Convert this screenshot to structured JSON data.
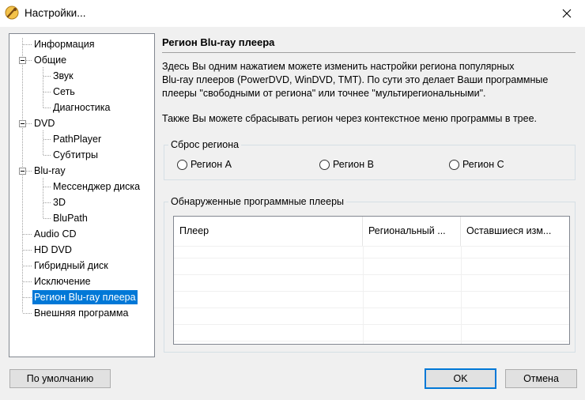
{
  "window": {
    "title": "Настройки...",
    "icon": "settings-app-icon",
    "close_icon": "close-icon"
  },
  "tree": {
    "items": [
      {
        "label": "Информация",
        "level": 0,
        "expanded": null
      },
      {
        "label": "Общие",
        "level": 0,
        "expanded": true
      },
      {
        "label": "Звук",
        "level": 1,
        "expanded": null
      },
      {
        "label": "Сеть",
        "level": 1,
        "expanded": null
      },
      {
        "label": "Диагностика",
        "level": 1,
        "expanded": null
      },
      {
        "label": "DVD",
        "level": 0,
        "expanded": true
      },
      {
        "label": "PathPlayer",
        "level": 1,
        "expanded": null
      },
      {
        "label": "Субтитры",
        "level": 1,
        "expanded": null
      },
      {
        "label": "Blu-ray",
        "level": 0,
        "expanded": true
      },
      {
        "label": "Мессенджер диска",
        "level": 1,
        "expanded": null
      },
      {
        "label": "3D",
        "level": 1,
        "expanded": null
      },
      {
        "label": "BluPath",
        "level": 1,
        "expanded": null
      },
      {
        "label": "Audio CD",
        "level": 0,
        "expanded": null
      },
      {
        "label": "HD DVD",
        "level": 0,
        "expanded": null
      },
      {
        "label": "Гибридный диск",
        "level": 0,
        "expanded": null
      },
      {
        "label": "Исключение",
        "level": 0,
        "expanded": null
      },
      {
        "label": "Регион Blu-ray плеера",
        "level": 0,
        "expanded": null,
        "selected": true
      },
      {
        "label": "Внешняя программа",
        "level": 0,
        "expanded": null
      }
    ]
  },
  "panel": {
    "title": "Регион Blu-ray плеера",
    "description_lines": [
      "Здесь Вы одним нажатием можете изменить настройки региона популярных",
      "Blu-ray плееров (PowerDVD, WinDVD, TMT). По сути это делает Ваши программные",
      "плееры \"свободными от региона\" или точнее \"мультирегиональными\"."
    ],
    "description2": "Также Вы можете сбрасывать регион через контекстное меню программы в трее.",
    "reset_group": {
      "legend": "Сброс региона",
      "radios": [
        {
          "label": "Регион A",
          "checked": false
        },
        {
          "label": "Регион B",
          "checked": false
        },
        {
          "label": "Регион C",
          "checked": false
        }
      ]
    },
    "players_group": {
      "legend": "Обнаруженные программные плееры",
      "columns": [
        "Плеер",
        "Региональный ...",
        "Оставшиеся изм..."
      ],
      "rows": []
    }
  },
  "buttons": {
    "defaults": "По умолчанию",
    "ok": "OK",
    "cancel": "Отмена"
  },
  "colors": {
    "selection": "#0078d7",
    "window_bg": "#f0f0f0"
  }
}
